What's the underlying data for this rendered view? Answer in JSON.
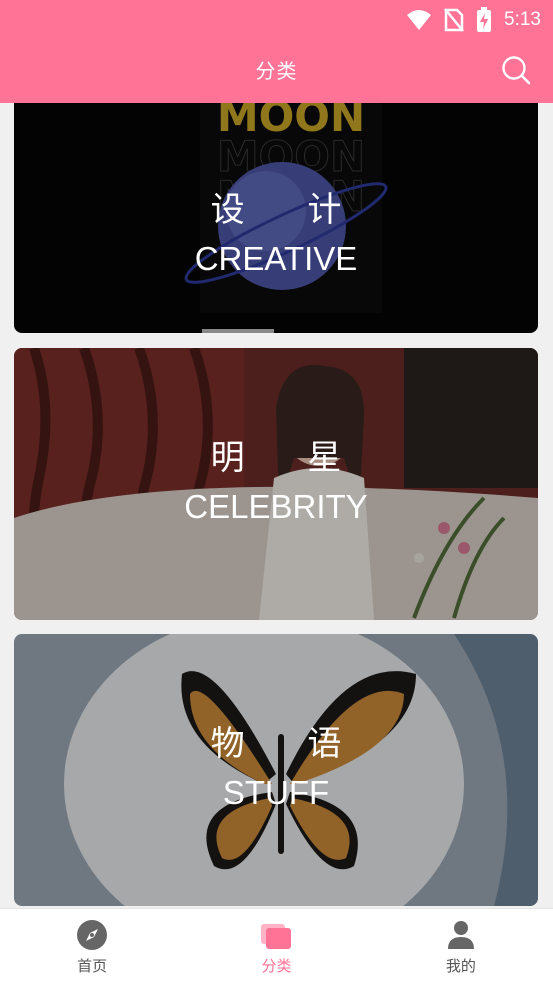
{
  "status_bar": {
    "time": "5:13"
  },
  "header": {
    "title": "分类"
  },
  "categories": [
    {
      "cn": "设 计",
      "en": "CREATIVE"
    },
    {
      "cn": "明 星",
      "en": "CELEBRITY"
    },
    {
      "cn": "物 语",
      "en": "STUFF"
    }
  ],
  "bottom_nav": [
    {
      "label": "首页",
      "icon": "compass-icon"
    },
    {
      "label": "分类",
      "icon": "category-cards-icon",
      "active": true
    },
    {
      "label": "我的",
      "icon": "person-icon"
    }
  ],
  "colors": {
    "accent": "#ff7397",
    "nav_inactive": "#555555"
  }
}
